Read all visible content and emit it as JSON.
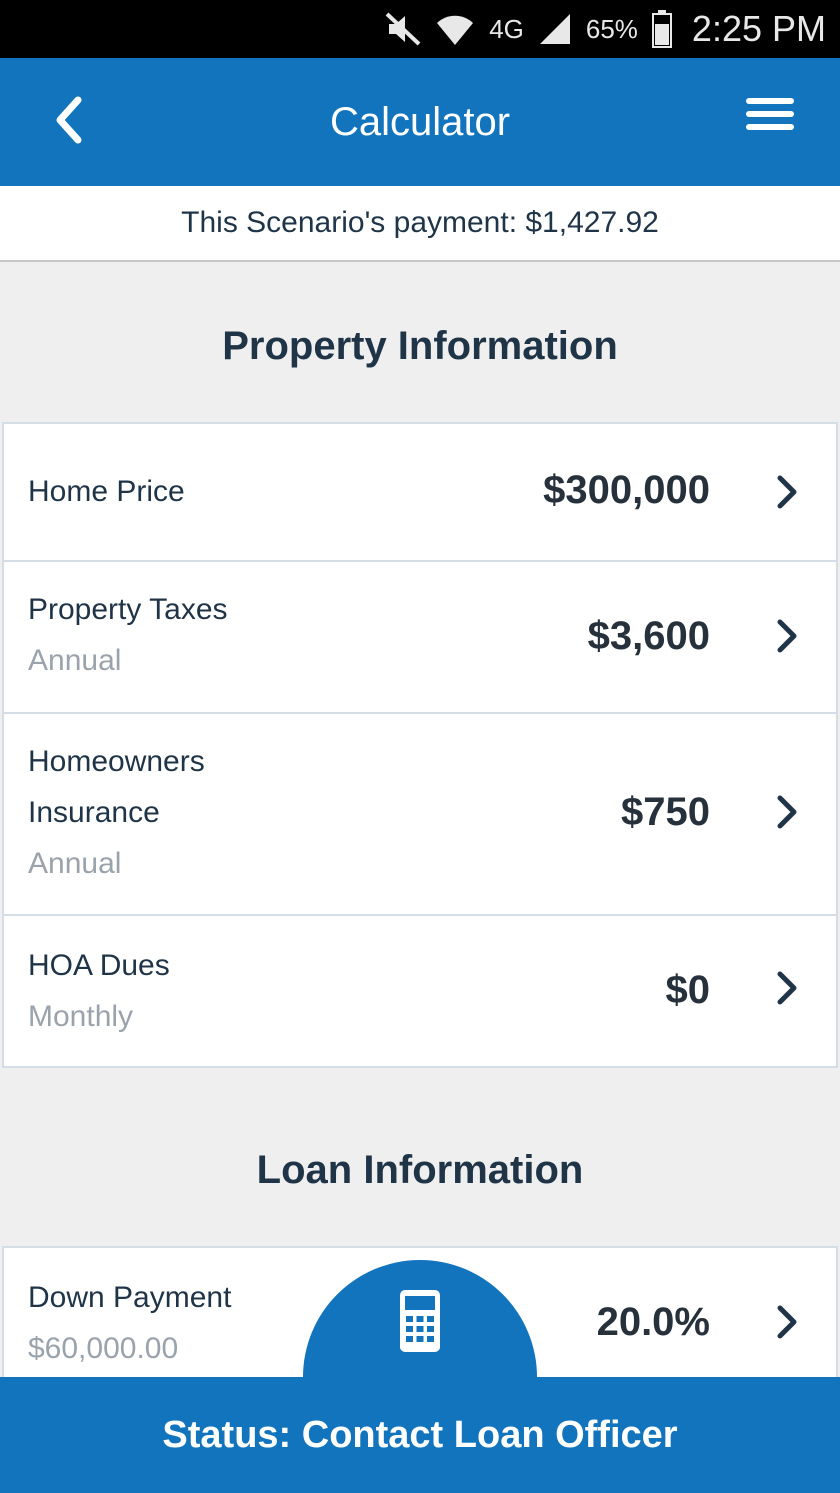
{
  "status_bar": {
    "network": "4G",
    "battery": "65%",
    "time": "2:25 PM",
    "icons": [
      "mute-icon",
      "wifi-icon",
      "network-icon",
      "signal-icon",
      "battery-icon"
    ]
  },
  "app_bar": {
    "title": "Calculator",
    "back_icon": "chevron-left-icon",
    "menu_icon": "hamburger-menu-icon"
  },
  "payment_summary": "This Scenario's payment: $1,427.92",
  "property_section": {
    "title": "Property Information",
    "rows": [
      {
        "label": "Home Price",
        "sub": "",
        "value": "$300,000"
      },
      {
        "label": "Property Taxes",
        "sub": "Annual",
        "value": "$3,600"
      },
      {
        "label_line1": "Homeowners",
        "label_line2": "Insurance",
        "sub": "Annual",
        "value": "$750"
      },
      {
        "label": "HOA Dues",
        "sub": "Monthly",
        "value": "$0"
      }
    ]
  },
  "loan_section": {
    "title": "Loan Information",
    "rows": [
      {
        "label": "Down Payment",
        "sub": "$60,000.00",
        "value": "20.0%"
      }
    ]
  },
  "fab_icon": "calculator-icon",
  "status_footer": "Status: Contact Loan Officer",
  "colors": {
    "brand_blue": "#1174bd",
    "text_dark": "#1f3447",
    "text_muted": "#9aa3ab",
    "background": "#efefef"
  }
}
